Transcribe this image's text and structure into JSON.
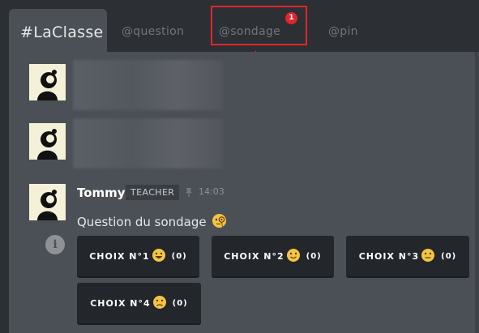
{
  "tabs": {
    "active": "#LaClasse",
    "items": [
      {
        "label": "@question"
      },
      {
        "label": "@sondage",
        "badge": "1"
      },
      {
        "label": "@pin"
      }
    ]
  },
  "message": {
    "author": "Tommy",
    "role": "TEACHER",
    "time": "14:03",
    "text": "Question du sondage",
    "text_emoji": "face-with-monocle"
  },
  "choices": [
    {
      "label": "CHOIX N°1",
      "emoji": "grinning-face",
      "count": "(0)"
    },
    {
      "label": "CHOIX N°2",
      "emoji": "slightly-smiling-face",
      "count": "(0)"
    },
    {
      "label": "CHOIX N°3",
      "emoji": "neutral-face",
      "count": "(0)"
    },
    {
      "label": "CHOIX N°4",
      "emoji": "frowning-face",
      "count": "(0)"
    }
  ],
  "colors": {
    "background": "#2c2f33",
    "panel": "#4b4f56",
    "button": "#23262a",
    "highlight": "#e0262d",
    "badge": "#e0262d",
    "avatar_bg": "#f5f1d8"
  }
}
